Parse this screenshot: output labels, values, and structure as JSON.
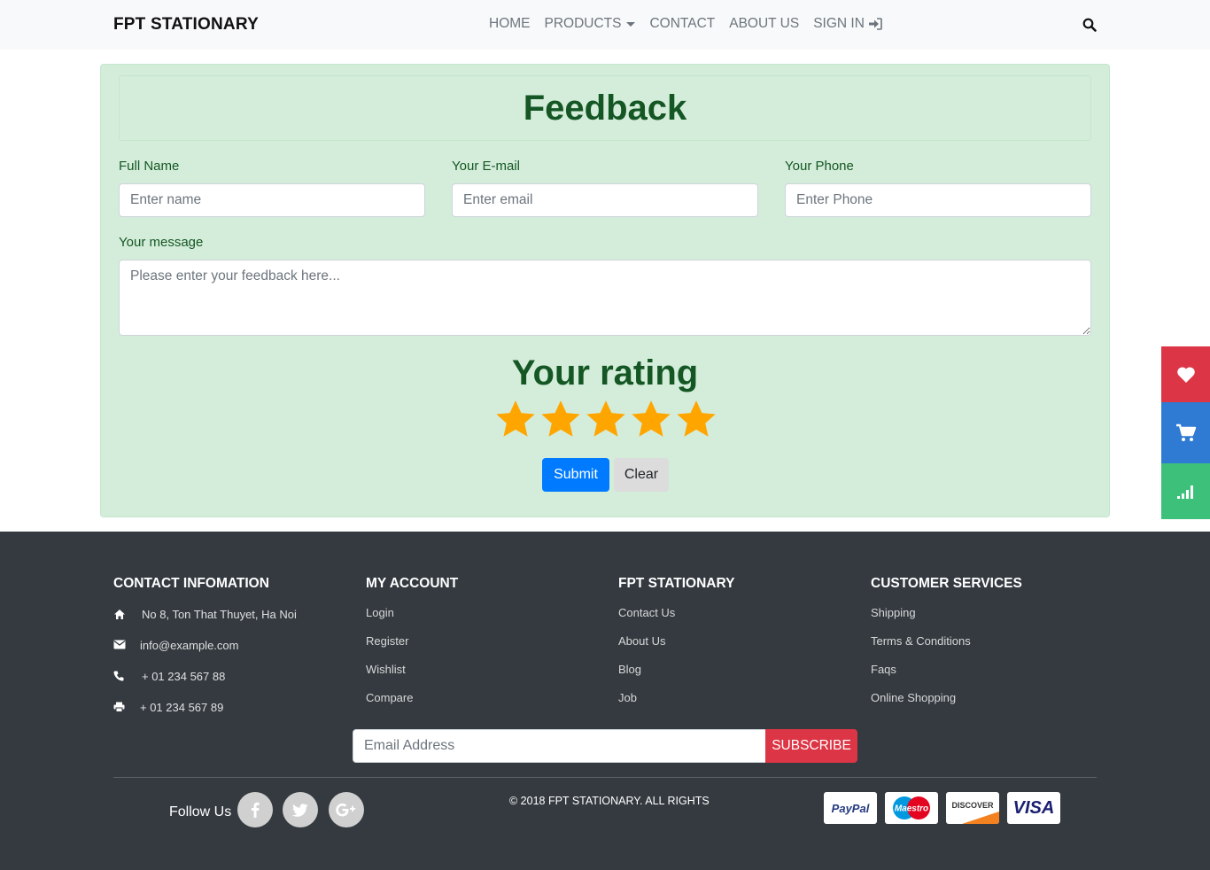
{
  "navbar": {
    "brand": "FPT STATIONARY",
    "links": [
      "HOME",
      "PRODUCTS",
      "CONTACT",
      "ABOUT US",
      "SIGN IN"
    ]
  },
  "feedback": {
    "title": "Feedback",
    "name_label": "Full Name",
    "name_placeholder": "Enter name",
    "email_label": "Your E-mail",
    "email_placeholder": "Enter email",
    "phone_label": "Your Phone",
    "phone_placeholder": "Enter Phone",
    "message_label": "Your message",
    "message_placeholder": "Please enter your feedback here...",
    "rating_title": "Your rating",
    "rating": 5,
    "star_color": "#ffa500",
    "submit_label": "Submit",
    "clear_label": "Clear"
  },
  "side": {
    "icons": [
      "heart-icon",
      "cart-icon",
      "signal-icon"
    ]
  },
  "footer": {
    "contact_title": "CONTACT INFOMATION",
    "address": "No 8, Ton That Thuyet, Ha Noi",
    "email": "info@example.com",
    "phone": "+ 01 234 567 88",
    "fax": "+ 01 234 567 89",
    "account_title": "MY ACCOUNT",
    "account_links": [
      "Login",
      "Register",
      "Wishlist",
      "Compare"
    ],
    "company_title": "FPT STATIONARY",
    "company_links": [
      "Contact Us",
      "About Us",
      "Blog",
      "Job"
    ],
    "services_title": "CUSTOMER SERVICES",
    "services_links": [
      "Shipping",
      "Terms & Conditions",
      "Faqs",
      "Online Shopping"
    ],
    "subscribe_placeholder": "Email Address",
    "subscribe_label": "SUBSCRIBE",
    "follow_label": "Follow Us",
    "copyright": "© 2018 FPT STATIONARY. ALL RIGHTS",
    "payments": [
      "PayPal",
      "Maestro",
      "DISCOVER",
      "VISA"
    ]
  }
}
